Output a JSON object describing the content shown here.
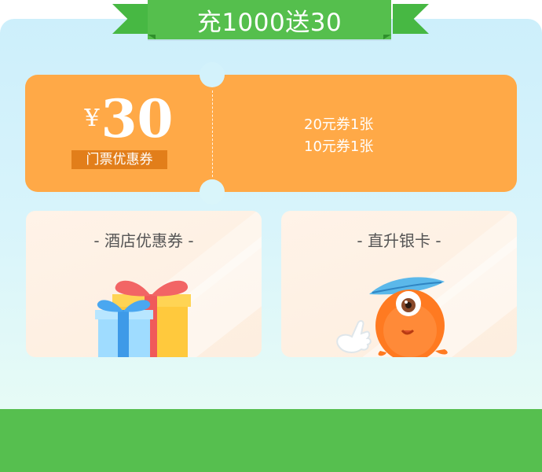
{
  "banner": {
    "title": "充1000送30"
  },
  "ticket": {
    "currency": "¥",
    "amount": "30",
    "tag": "门票优惠券",
    "lines": [
      "20元券1张",
      "10元券1张"
    ]
  },
  "cards": [
    {
      "title": "- 酒店优惠券 -",
      "icon": "gift-boxes-icon"
    },
    {
      "title": "- 直升银卡 -",
      "icon": "orange-mascot-icon"
    }
  ],
  "colors": {
    "green": "#55bf4d",
    "orange": "#ffa947",
    "orange_dark": "#e27e1a",
    "card_bg": "#fff3e8",
    "sky": "#cdeffb"
  }
}
